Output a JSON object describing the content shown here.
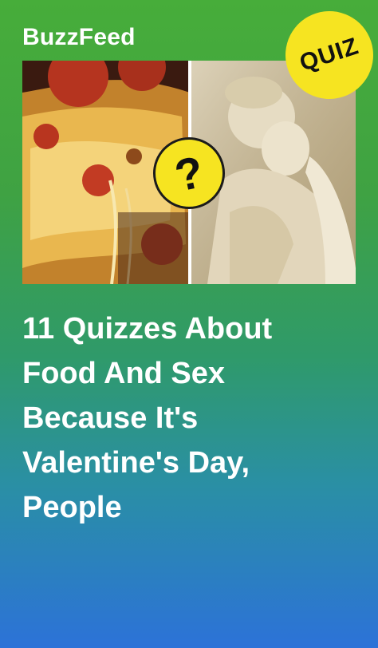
{
  "brand": {
    "name": "BuzzFeed"
  },
  "badges": {
    "quiz_label": "QUIZ",
    "question_mark": "?"
  },
  "headline": {
    "lines": [
      "11 Quizzes About",
      "Food And Sex",
      "Because It's",
      "Valentine's Day,",
      "People"
    ]
  },
  "colors": {
    "gradient_top": "#47ad3a",
    "gradient_bottom": "#2c72d8",
    "badge_yellow": "#f6e421",
    "text": "#ffffff"
  }
}
